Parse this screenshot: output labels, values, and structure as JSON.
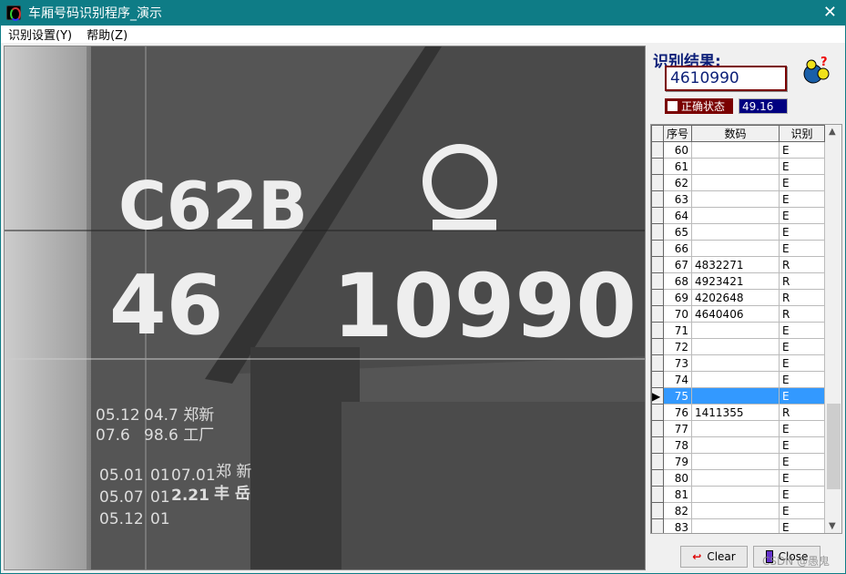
{
  "window": {
    "title": "车厢号码识别程序_演示",
    "close": "✕"
  },
  "menu": [
    {
      "label": "识别设置(Y)"
    },
    {
      "label": "帮助(Z)"
    }
  ],
  "photo": {
    "car_type": "C62B",
    "number_prefix": "46",
    "number_main": "10990",
    "marks": [
      "05.12",
      "04.7 郑新",
      "07.6",
      "98.6 工厂",
      "05.01",
      "01",
      "07.01",
      "郑 新",
      "05.07",
      "01",
      "2.21",
      "丰 岳",
      "05.12",
      "01"
    ]
  },
  "result": {
    "label": "识别结果:",
    "value": "4610990",
    "status_label": "正确状态",
    "status_checked": false,
    "score": "49.16"
  },
  "table": {
    "headers": [
      "序号",
      "数码",
      "识别"
    ],
    "rows": [
      {
        "no": "60",
        "code": "",
        "rec": "E"
      },
      {
        "no": "61",
        "code": "",
        "rec": "E"
      },
      {
        "no": "62",
        "code": "",
        "rec": "E"
      },
      {
        "no": "63",
        "code": "",
        "rec": "E"
      },
      {
        "no": "64",
        "code": "",
        "rec": "E"
      },
      {
        "no": "65",
        "code": "",
        "rec": "E"
      },
      {
        "no": "66",
        "code": "",
        "rec": "E"
      },
      {
        "no": "67",
        "code": "4832271",
        "rec": "R"
      },
      {
        "no": "68",
        "code": "4923421",
        "rec": "R"
      },
      {
        "no": "69",
        "code": "4202648",
        "rec": "R"
      },
      {
        "no": "70",
        "code": "4640406",
        "rec": "R"
      },
      {
        "no": "71",
        "code": "",
        "rec": "E"
      },
      {
        "no": "72",
        "code": "",
        "rec": "E"
      },
      {
        "no": "73",
        "code": "",
        "rec": "E"
      },
      {
        "no": "74",
        "code": "",
        "rec": "E"
      },
      {
        "no": "75",
        "code": "",
        "rec": "E",
        "selected": true
      },
      {
        "no": "76",
        "code": "1411355",
        "rec": "R"
      },
      {
        "no": "77",
        "code": "",
        "rec": "E"
      },
      {
        "no": "78",
        "code": "",
        "rec": "E"
      },
      {
        "no": "79",
        "code": "",
        "rec": "E"
      },
      {
        "no": "80",
        "code": "",
        "rec": "E"
      },
      {
        "no": "81",
        "code": "",
        "rec": "E"
      },
      {
        "no": "82",
        "code": "",
        "rec": "E"
      },
      {
        "no": "83",
        "code": "",
        "rec": "E"
      }
    ]
  },
  "buttons": {
    "clear": "Clear",
    "close": "Close"
  },
  "watermark": "CSDN @愚鬼",
  "colors": {
    "titlebar": "#0e7c86",
    "selection": "#3399ff",
    "result_border": "#7a0000",
    "score_bg": "#000080"
  }
}
